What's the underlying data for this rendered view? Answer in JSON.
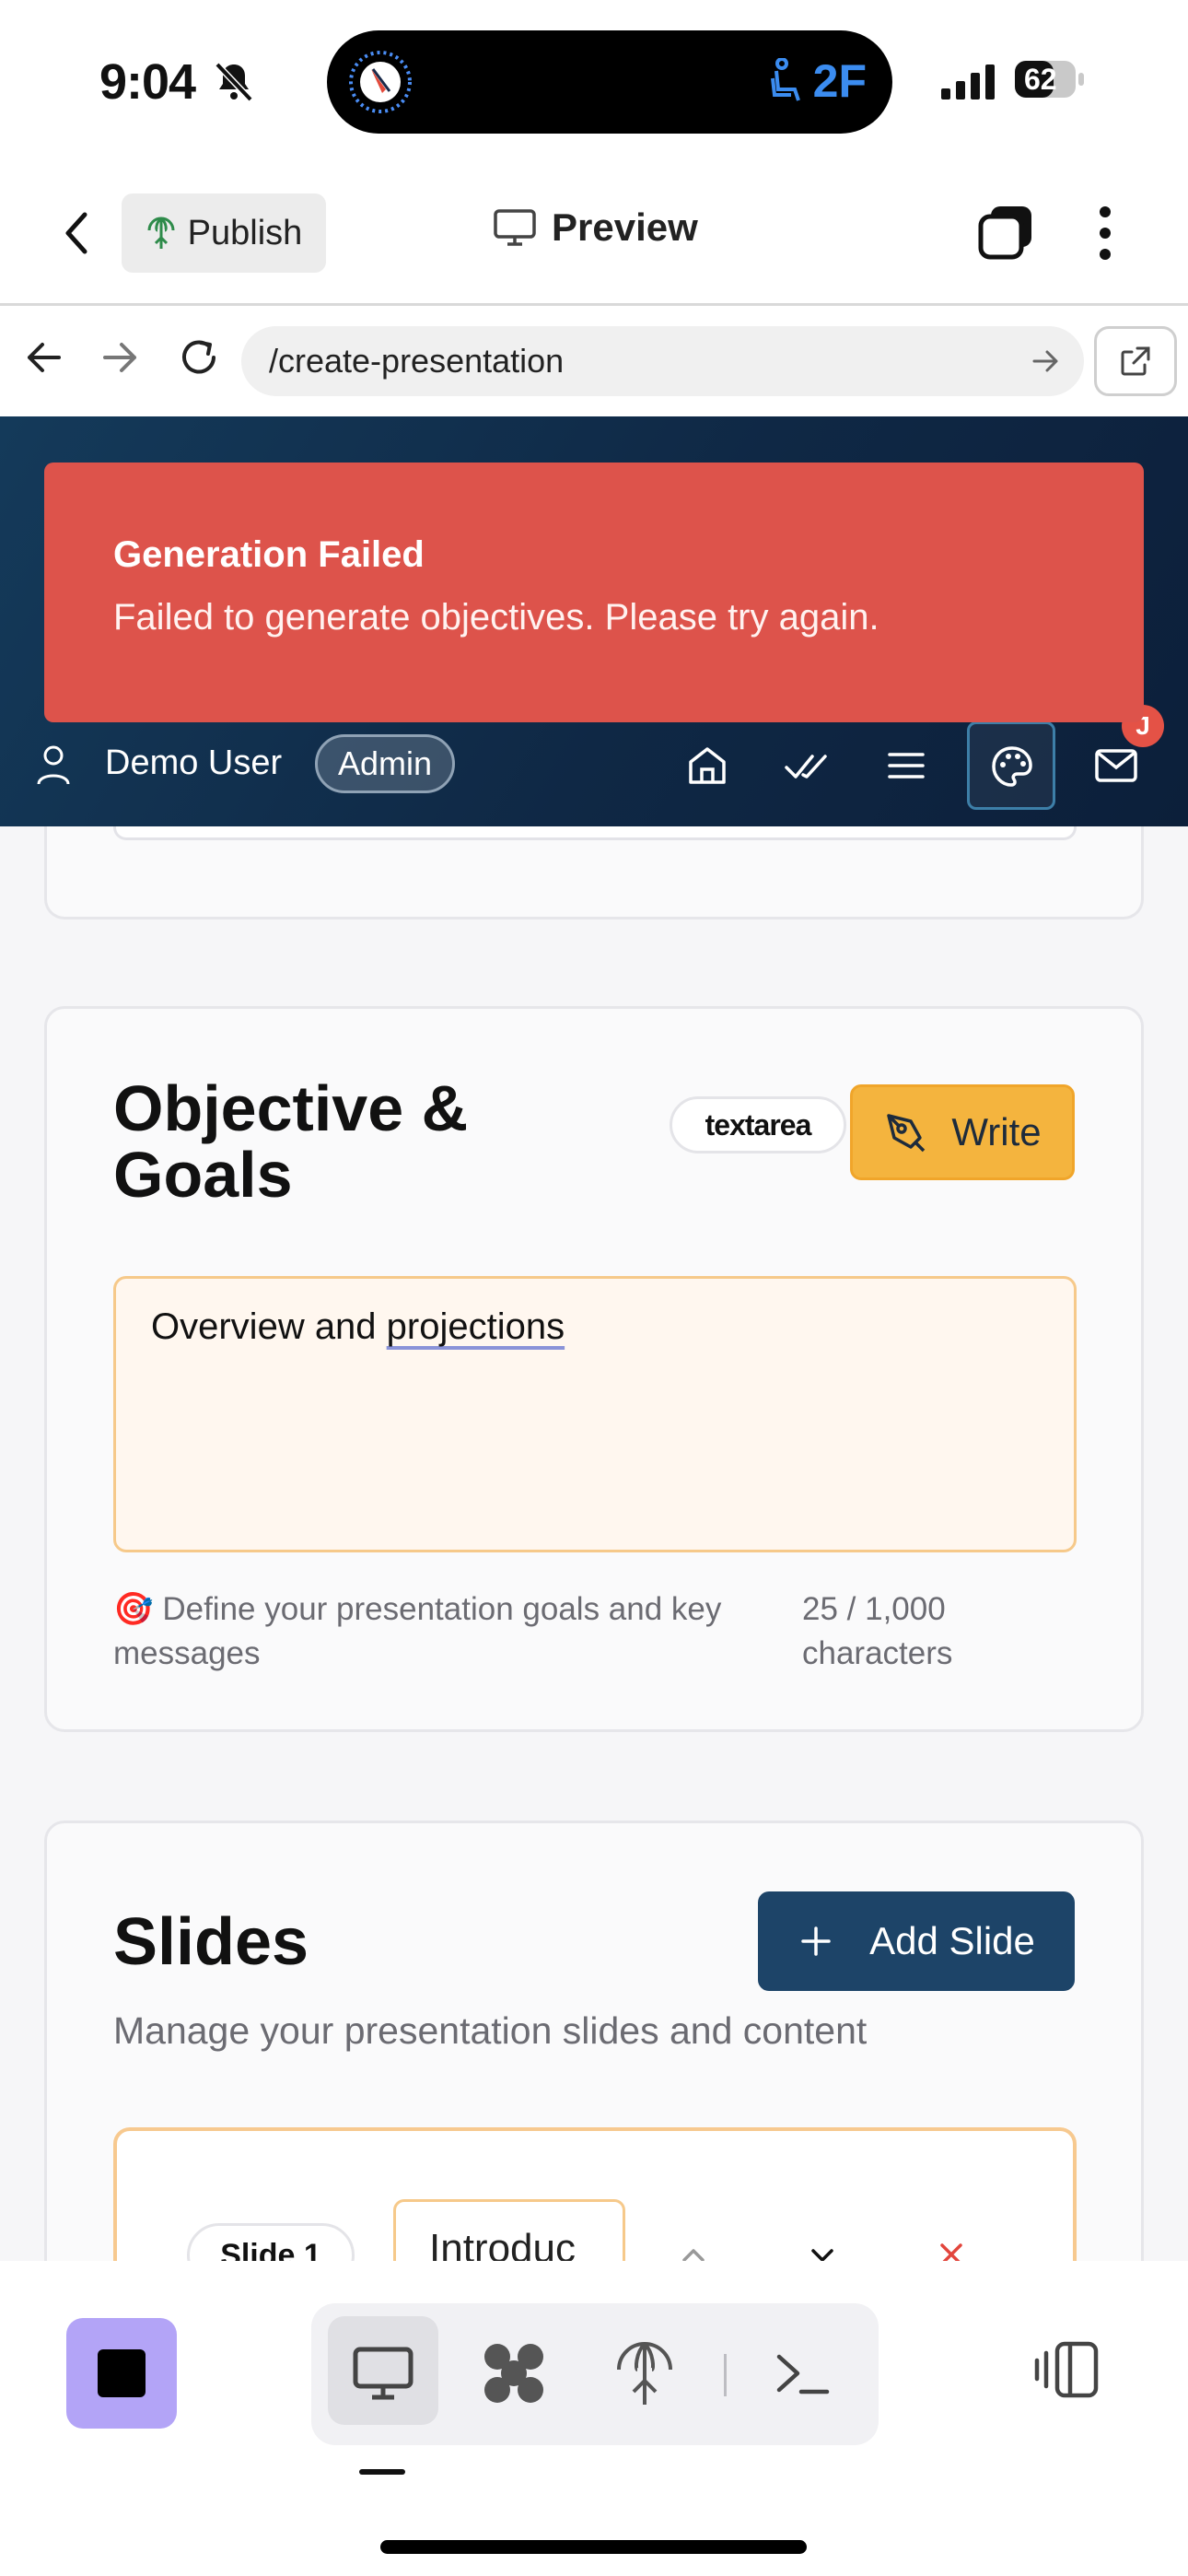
{
  "status_bar": {
    "time": "9:04",
    "island_seat": "2F",
    "battery": "62"
  },
  "app_header": {
    "publish_label": "Publish",
    "preview_label": "Preview"
  },
  "browser": {
    "url": "/create-presentation"
  },
  "toast": {
    "title": "Generation Failed",
    "message": "Failed to generate objectives. Please try again."
  },
  "user_bar": {
    "user_name": "Demo User",
    "role_badge": "Admin",
    "notification_badge": "J"
  },
  "objective_section": {
    "title": "Objective & Goals",
    "type_badge": "textarea",
    "write_label": "Write",
    "value": "Overview and projections",
    "helper_emoji": "🎯",
    "helper": "Define your presentation goals and key messages",
    "char_count": "25 / 1,000 characters"
  },
  "slides_section": {
    "title": "Slides",
    "add_label": "Add Slide",
    "subtitle": "Manage your presentation slides and content",
    "items": [
      {
        "number_label": "Slide 1",
        "title_value": "Introduc"
      }
    ]
  },
  "colors": {
    "toast_bg": "#dd534b",
    "nav_band": "#0f2845",
    "write_button": "#f4b43e",
    "add_slide_button": "#1d4468",
    "stop_button": "#b3a4f7"
  }
}
